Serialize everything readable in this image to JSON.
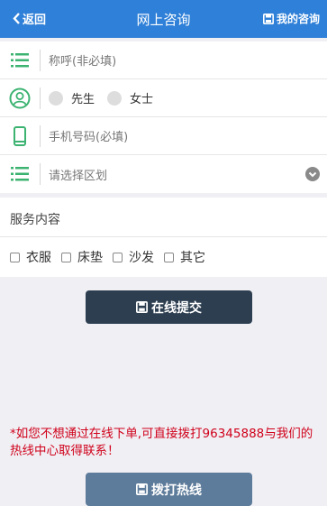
{
  "header": {
    "back_label": "返回",
    "title": "网上咨询",
    "mine_label": "我的咨询"
  },
  "form": {
    "name_placeholder": "称呼(非必填)",
    "gender_options": [
      "先生",
      "女士"
    ],
    "phone_placeholder": "手机号码(必填)",
    "region_placeholder": "请选择区划"
  },
  "service": {
    "label": "服务内容",
    "options": [
      "衣服",
      "床垫",
      "沙发",
      "其它"
    ]
  },
  "submit_label": "在线提交",
  "notice": "*如您不想通过在线下单,可直接拨打96345888与我们的热线中心取得联系！",
  "call_label": "拨打热线",
  "colors": {
    "header": "#2f80d8",
    "icon_green": "#3cb371",
    "submit": "#2c3e50",
    "call": "#5d7b9a",
    "notice": "#d0021b"
  }
}
